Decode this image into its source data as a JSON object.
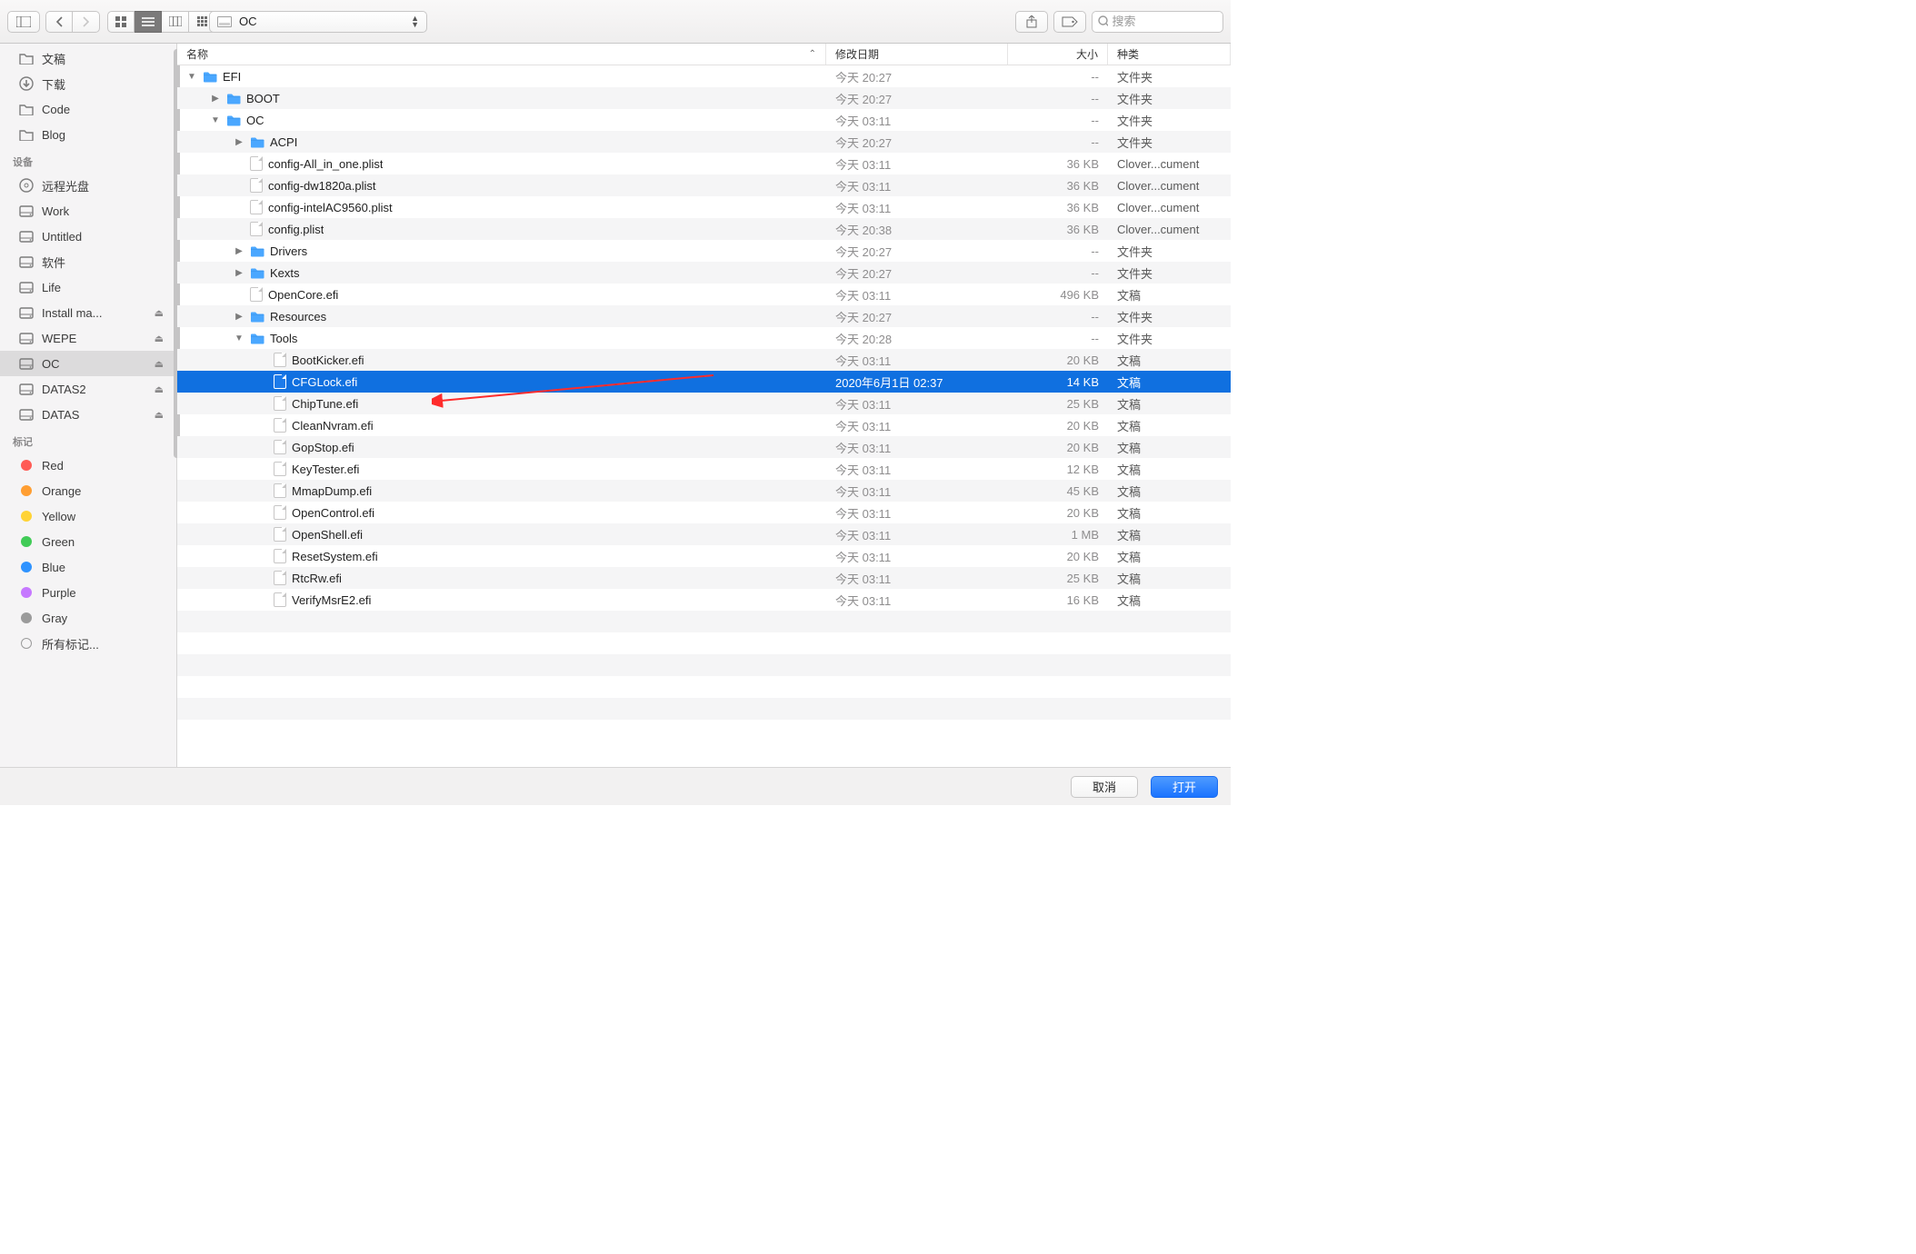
{
  "toolbar": {
    "path_title": "OC",
    "search_placeholder": "搜索"
  },
  "sidebar": {
    "favorites": [
      {
        "label": "文稿",
        "icon": "folder"
      },
      {
        "label": "下载",
        "icon": "download"
      },
      {
        "label": "Code",
        "icon": "folder"
      },
      {
        "label": "Blog",
        "icon": "folder"
      }
    ],
    "devices_header": "设备",
    "devices": [
      {
        "label": "远程光盘",
        "icon": "disc",
        "eject": false
      },
      {
        "label": "Work",
        "icon": "hdd",
        "eject": false
      },
      {
        "label": "Untitled",
        "icon": "hdd",
        "eject": false
      },
      {
        "label": "软件",
        "icon": "hdd",
        "eject": false
      },
      {
        "label": "Life",
        "icon": "hdd",
        "eject": false
      },
      {
        "label": "Install ma...",
        "icon": "hdd",
        "eject": true
      },
      {
        "label": "WEPE",
        "icon": "hdd",
        "eject": true
      },
      {
        "label": "OC",
        "icon": "hdd",
        "eject": true,
        "selected": true
      },
      {
        "label": "DATAS2",
        "icon": "hdd",
        "eject": true
      },
      {
        "label": "DATAS",
        "icon": "hdd",
        "eject": true
      }
    ],
    "tags_header": "标记",
    "tags": [
      {
        "label": "Red",
        "color": "#ff5b55"
      },
      {
        "label": "Orange",
        "color": "#ff9e32"
      },
      {
        "label": "Yellow",
        "color": "#ffd335"
      },
      {
        "label": "Green",
        "color": "#41cb57"
      },
      {
        "label": "Blue",
        "color": "#2f93ff"
      },
      {
        "label": "Purple",
        "color": "#c678ff"
      },
      {
        "label": "Gray",
        "color": "#9b9b9b"
      },
      {
        "label": "所有标记...",
        "color": null
      }
    ]
  },
  "columns": {
    "name": "名称",
    "date": "修改日期",
    "size": "大小",
    "kind": "种类"
  },
  "rows": [
    {
      "depth": 0,
      "disclosure": "down",
      "icon": "folder",
      "name": "EFI",
      "date": "今天 20:27",
      "size": "--",
      "kind": "文件夹"
    },
    {
      "depth": 1,
      "disclosure": "right",
      "icon": "folder",
      "name": "BOOT",
      "date": "今天 20:27",
      "size": "--",
      "kind": "文件夹"
    },
    {
      "depth": 1,
      "disclosure": "down",
      "icon": "folder",
      "name": "OC",
      "date": "今天 03:11",
      "size": "--",
      "kind": "文件夹"
    },
    {
      "depth": 2,
      "disclosure": "right",
      "icon": "folder",
      "name": "ACPI",
      "date": "今天 20:27",
      "size": "--",
      "kind": "文件夹"
    },
    {
      "depth": 2,
      "disclosure": "",
      "icon": "file",
      "name": "config-All_in_one.plist",
      "date": "今天 03:11",
      "size": "36 KB",
      "kind": "Clover...cument"
    },
    {
      "depth": 2,
      "disclosure": "",
      "icon": "file",
      "name": "config-dw1820a.plist",
      "date": "今天 03:11",
      "size": "36 KB",
      "kind": "Clover...cument"
    },
    {
      "depth": 2,
      "disclosure": "",
      "icon": "file",
      "name": "config-intelAC9560.plist",
      "date": "今天 03:11",
      "size": "36 KB",
      "kind": "Clover...cument"
    },
    {
      "depth": 2,
      "disclosure": "",
      "icon": "file",
      "name": "config.plist",
      "date": "今天 20:38",
      "size": "36 KB",
      "kind": "Clover...cument"
    },
    {
      "depth": 2,
      "disclosure": "right",
      "icon": "folder",
      "name": "Drivers",
      "date": "今天 20:27",
      "size": "--",
      "kind": "文件夹"
    },
    {
      "depth": 2,
      "disclosure": "right",
      "icon": "folder",
      "name": "Kexts",
      "date": "今天 20:27",
      "size": "--",
      "kind": "文件夹"
    },
    {
      "depth": 2,
      "disclosure": "",
      "icon": "file",
      "name": "OpenCore.efi",
      "date": "今天 03:11",
      "size": "496 KB",
      "kind": "文稿"
    },
    {
      "depth": 2,
      "disclosure": "right",
      "icon": "folder",
      "name": "Resources",
      "date": "今天 20:27",
      "size": "--",
      "kind": "文件夹"
    },
    {
      "depth": 2,
      "disclosure": "down",
      "icon": "folder",
      "name": "Tools",
      "date": "今天 20:28",
      "size": "--",
      "kind": "文件夹"
    },
    {
      "depth": 3,
      "disclosure": "",
      "icon": "file",
      "name": "BootKicker.efi",
      "date": "今天 03:11",
      "size": "20 KB",
      "kind": "文稿"
    },
    {
      "depth": 3,
      "disclosure": "",
      "icon": "file",
      "name": "CFGLock.efi",
      "date": "2020年6月1日 02:37",
      "size": "14 KB",
      "kind": "文稿",
      "selected": true
    },
    {
      "depth": 3,
      "disclosure": "",
      "icon": "file",
      "name": "ChipTune.efi",
      "date": "今天 03:11",
      "size": "25 KB",
      "kind": "文稿"
    },
    {
      "depth": 3,
      "disclosure": "",
      "icon": "file",
      "name": "CleanNvram.efi",
      "date": "今天 03:11",
      "size": "20 KB",
      "kind": "文稿"
    },
    {
      "depth": 3,
      "disclosure": "",
      "icon": "file",
      "name": "GopStop.efi",
      "date": "今天 03:11",
      "size": "20 KB",
      "kind": "文稿"
    },
    {
      "depth": 3,
      "disclosure": "",
      "icon": "file",
      "name": "KeyTester.efi",
      "date": "今天 03:11",
      "size": "12 KB",
      "kind": "文稿"
    },
    {
      "depth": 3,
      "disclosure": "",
      "icon": "file",
      "name": "MmapDump.efi",
      "date": "今天 03:11",
      "size": "45 KB",
      "kind": "文稿"
    },
    {
      "depth": 3,
      "disclosure": "",
      "icon": "file",
      "name": "OpenControl.efi",
      "date": "今天 03:11",
      "size": "20 KB",
      "kind": "文稿"
    },
    {
      "depth": 3,
      "disclosure": "",
      "icon": "file",
      "name": "OpenShell.efi",
      "date": "今天 03:11",
      "size": "1 MB",
      "kind": "文稿"
    },
    {
      "depth": 3,
      "disclosure": "",
      "icon": "file",
      "name": "ResetSystem.efi",
      "date": "今天 03:11",
      "size": "20 KB",
      "kind": "文稿"
    },
    {
      "depth": 3,
      "disclosure": "",
      "icon": "file",
      "name": "RtcRw.efi",
      "date": "今天 03:11",
      "size": "25 KB",
      "kind": "文稿"
    },
    {
      "depth": 3,
      "disclosure": "",
      "icon": "file",
      "name": "VerifyMsrE2.efi",
      "date": "今天 03:11",
      "size": "16 KB",
      "kind": "文稿"
    }
  ],
  "footer": {
    "cancel": "取消",
    "open": "打开"
  }
}
